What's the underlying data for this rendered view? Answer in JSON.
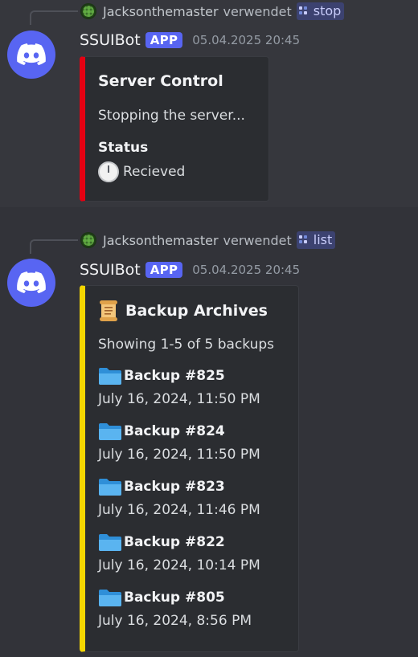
{
  "messages": [
    {
      "reply": {
        "user": "Jacksonthemaster",
        "verb": "verwendet",
        "command": "stop"
      },
      "author": "SSUIBot",
      "app_tag": "APP",
      "timestamp": "05.04.2025 20:45",
      "embed": {
        "accent_color": "#e50012",
        "title": "Server Control",
        "description": "Stopping the server...",
        "field_name": "Status",
        "field_value": "Recieved",
        "field_icon": "clock-icon"
      }
    },
    {
      "reply": {
        "user": "Jacksonthemaster",
        "verb": "verwendet",
        "command": "list"
      },
      "author": "SSUIBot",
      "app_tag": "APP",
      "timestamp": "05.04.2025 20:45",
      "embed": {
        "accent_color": "#f5d600",
        "title_icon": "scroll-icon",
        "title": "Backup Archives",
        "description": "Showing 1-5 of 5 backups",
        "backups": [
          {
            "icon": "folder-icon",
            "name": "Backup #825",
            "date": "July 16, 2024, 11:50 PM"
          },
          {
            "icon": "folder-icon",
            "name": "Backup #824",
            "date": "July 16, 2024, 11:50 PM"
          },
          {
            "icon": "folder-icon",
            "name": "Backup #823",
            "date": "July 16, 2024, 11:46 PM"
          },
          {
            "icon": "folder-icon",
            "name": "Backup #822",
            "date": "July 16, 2024, 10:14 PM"
          },
          {
            "icon": "folder-icon",
            "name": "Backup #805",
            "date": "July 16, 2024, 8:56 PM"
          }
        ]
      }
    }
  ],
  "colors": {
    "background": "#323339",
    "blurple": "#5865f2",
    "embed_bg": "#2b2d31",
    "command_chip": "#3c4270"
  }
}
